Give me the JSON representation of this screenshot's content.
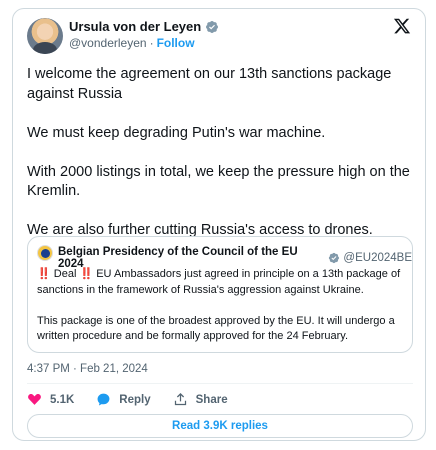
{
  "author": {
    "name": "Ursula von der Leyen",
    "handle": "@vonderleyen",
    "follow_label": "Follow",
    "separator": "·"
  },
  "tweet": {
    "paragraphs": [
      "I welcome the agreement on our 13th sanctions package against Russia",
      "We must keep degrading Putin's war machine.",
      "With 2000 listings in total, we keep the pressure high on the Kremlin.",
      "We are also further cutting Russia's access to drones."
    ]
  },
  "quote": {
    "name": "Belgian Presidency of the Council of the EU 2024",
    "handle": "@EU2024BE",
    "bang": "‼️",
    "deal": "Deal",
    "line1_rest": "EU Ambassadors just agreed in principle on a 13th package of sanctions in the framework of Russia's aggression against Ukraine.",
    "paragraph2": "This package is one of the broadest approved by the EU. It will undergo a written procedure and be formally approved for the 24 February."
  },
  "meta": {
    "timestamp": "4:37 PM · Feb 21, 2024"
  },
  "actions": {
    "likes": "5.1K",
    "reply_label": "Reply",
    "share_label": "Share"
  },
  "replies_button": "Read 3.9K replies",
  "colors": {
    "accent": "#1d9bf0",
    "like": "#f91880",
    "text": "#0f1419",
    "muted": "#536471"
  },
  "icons": [
    "verified-badge-icon",
    "x-logo-icon",
    "heart-icon",
    "reply-icon",
    "share-icon"
  ]
}
